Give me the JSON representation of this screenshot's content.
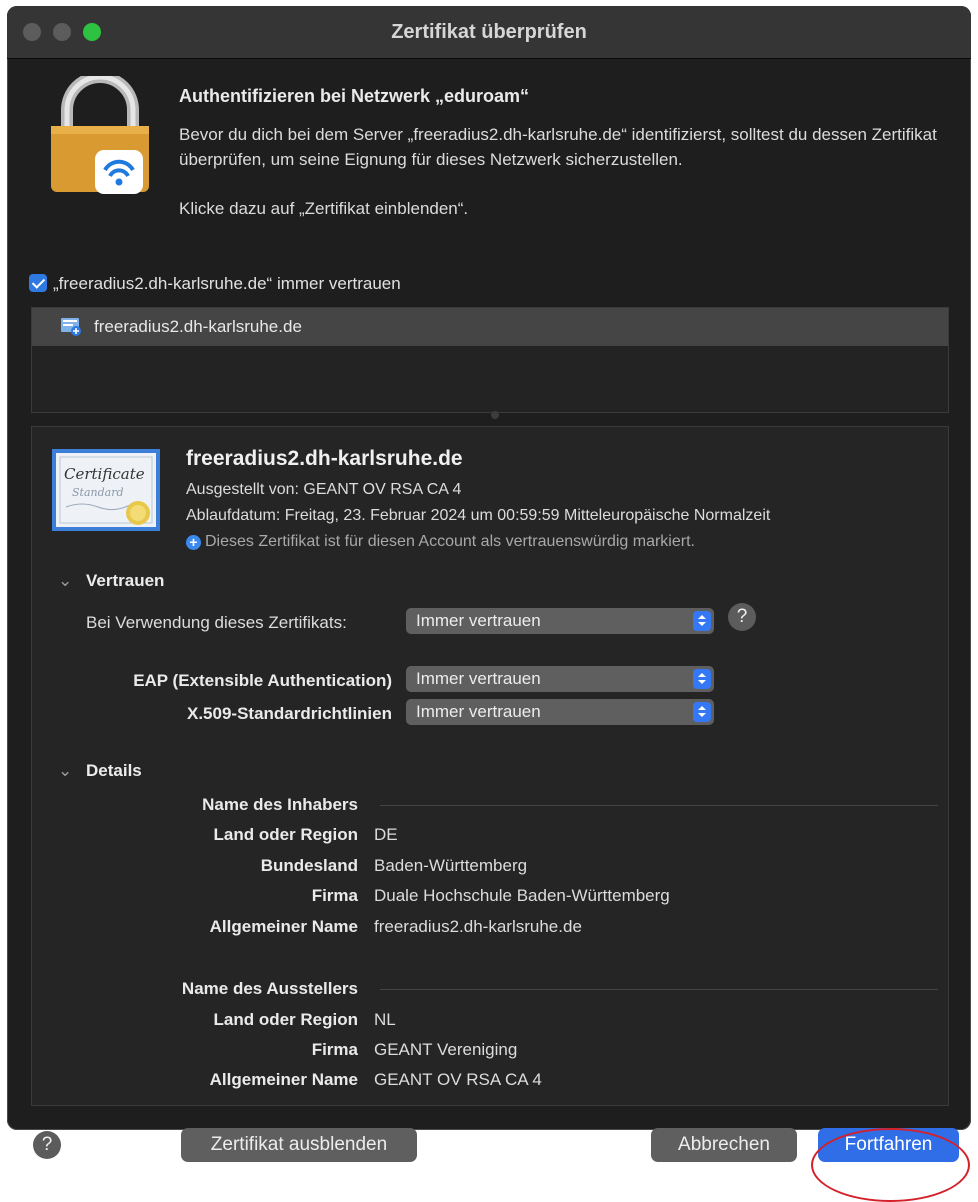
{
  "window": {
    "title": "Zertifikat überprüfen"
  },
  "header": {
    "heading": "Authentifizieren bei Netzwerk „eduroam“",
    "message": "Bevor du dich bei dem Server „freeradius2.dh-karlsruhe.de“ identifizierst, solltest du dessen Zertifikat überprüfen, um seine Eignung für dieses Netzwerk sicherzustellen.",
    "message2": "Klicke dazu auf „Zertifikat einblenden“."
  },
  "trust_checkbox": {
    "label": "„freeradius2.dh-karlsruhe.de“ immer vertrauen",
    "checked": true
  },
  "cert_list": {
    "items": [
      "freeradius2.dh-karlsruhe.de"
    ]
  },
  "certificate": {
    "name": "freeradius2.dh-karlsruhe.de",
    "issued_by": "Ausgestellt von: GEANT OV RSA CA 4",
    "expiry": "Ablaufdatum: Freitag, 23. Februar 2024 um 00:59:59 Mitteleuropäische Normalzeit",
    "trust_note": "Dieses Zertifikat ist für diesen Account als vertrauenswürdig markiert.",
    "image_text_1": "Certificate",
    "image_text_2": "Standard"
  },
  "trust_section": {
    "title": "Vertrauen",
    "when_using_label": "Bei Verwendung dieses Zertifikats:",
    "when_using_value": "Immer vertrauen",
    "eap_label": "EAP (Extensible Authentication)",
    "eap_value": "Immer vertrauen",
    "x509_label": "X.509-Standardrichtlinien",
    "x509_value": "Immer vertrauen",
    "help": "?"
  },
  "details_section": {
    "title": "Details",
    "subject_heading": "Name des Inhabers",
    "subject": [
      {
        "label": "Land oder Region",
        "value": "DE"
      },
      {
        "label": "Bundesland",
        "value": "Baden-Württemberg"
      },
      {
        "label": "Firma",
        "value": "Duale Hochschule Baden-Württemberg"
      },
      {
        "label": "Allgemeiner Name",
        "value": "freeradius2.dh-karlsruhe.de"
      }
    ],
    "issuer_heading": "Name des Ausstellers",
    "issuer": [
      {
        "label": "Land oder Region",
        "value": "NL"
      },
      {
        "label": "Firma",
        "value": "GEANT Vereniging"
      },
      {
        "label": "Allgemeiner Name",
        "value": "GEANT OV RSA CA 4"
      }
    ]
  },
  "footer": {
    "help": "?",
    "hide_cert": "Zertifikat ausblenden",
    "cancel": "Abbrechen",
    "continue": "Fortfahren"
  },
  "colors": {
    "accent": "#2f6ee6",
    "annotation_ring": "#d3202a",
    "window_bg": "#1e1e1e"
  }
}
